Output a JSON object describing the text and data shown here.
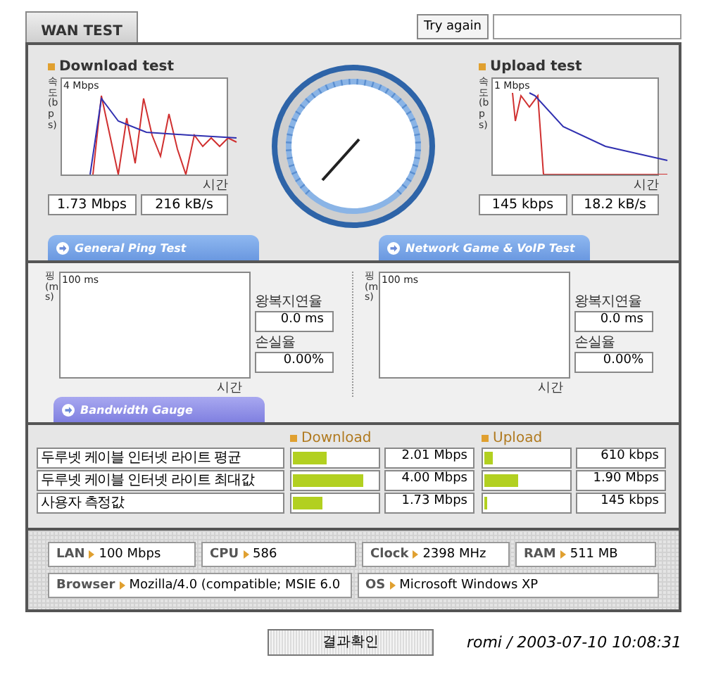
{
  "header": {
    "tab": "WAN TEST",
    "retry_button": "Try again"
  },
  "download": {
    "title": "Download test",
    "y_axis": "속도(bps)",
    "top_label": "4 Mbps",
    "x_axis": "시간",
    "rate": "1.73 Mbps",
    "throughput": "216 kB/s"
  },
  "upload": {
    "title": "Upload test",
    "y_axis": "속도(bps)",
    "top_label": "1 Mbps",
    "x_axis": "시간",
    "rate": "145 kbps",
    "throughput": "18.2 kB/s"
  },
  "ping_tabs": [
    "General Ping Test",
    "Network Game & VoIP Test"
  ],
  "ping_panels": [
    {
      "y_axis": "핑(ms)",
      "top_label": "100 ms",
      "x_axis": "시간",
      "latency_label": "왕복지연율",
      "latency": "0.0 ms",
      "loss_label": "손실율",
      "loss": "0.00%"
    },
    {
      "y_axis": "핑(ms)",
      "top_label": "100 ms",
      "x_axis": "시간",
      "latency_label": "왕복지연율",
      "latency": "0.0 ms",
      "loss_label": "손실율",
      "loss": "0.00%"
    }
  ],
  "bandwidth_tab": "Bandwidth Gauge",
  "bandwidth": {
    "download_header": "Download",
    "upload_header": "Upload",
    "rows": [
      {
        "name": "두루넷 케이블 인터넷 라이트 평균",
        "download": {
          "level": 0.4,
          "reading": "2.01 Mbps"
        },
        "upload": {
          "level": 0.1,
          "reading": "610 kbps"
        }
      },
      {
        "name": "두루넷 케이블 인터넷 라이트 최대값",
        "download": {
          "level": 0.83,
          "reading": "4.00 Mbps"
        },
        "upload": {
          "level": 0.4,
          "reading": "1.90 Mbps"
        }
      },
      {
        "name": "사용자 측정값",
        "download": {
          "level": 0.35,
          "reading": "1.73 Mbps"
        },
        "upload": {
          "level": 0.03,
          "reading": "145 kbps"
        }
      }
    ]
  },
  "system_info": [
    [
      {
        "label": "LAN",
        "value": "100 Mbps"
      },
      {
        "label": "CPU",
        "value": "586"
      },
      {
        "label": "Clock",
        "value": "2398 MHz"
      },
      {
        "label": "RAM",
        "value": "511 MB"
      }
    ],
    [
      {
        "label": "Browser",
        "value": "Mozilla/4.0 (compatible; MSIE 6.0"
      },
      {
        "label": "OS",
        "value": "Microsoft Windows XP"
      }
    ]
  ],
  "result_button": "결과확인",
  "signature": "romi / 2003-07-10 10:08:31"
}
